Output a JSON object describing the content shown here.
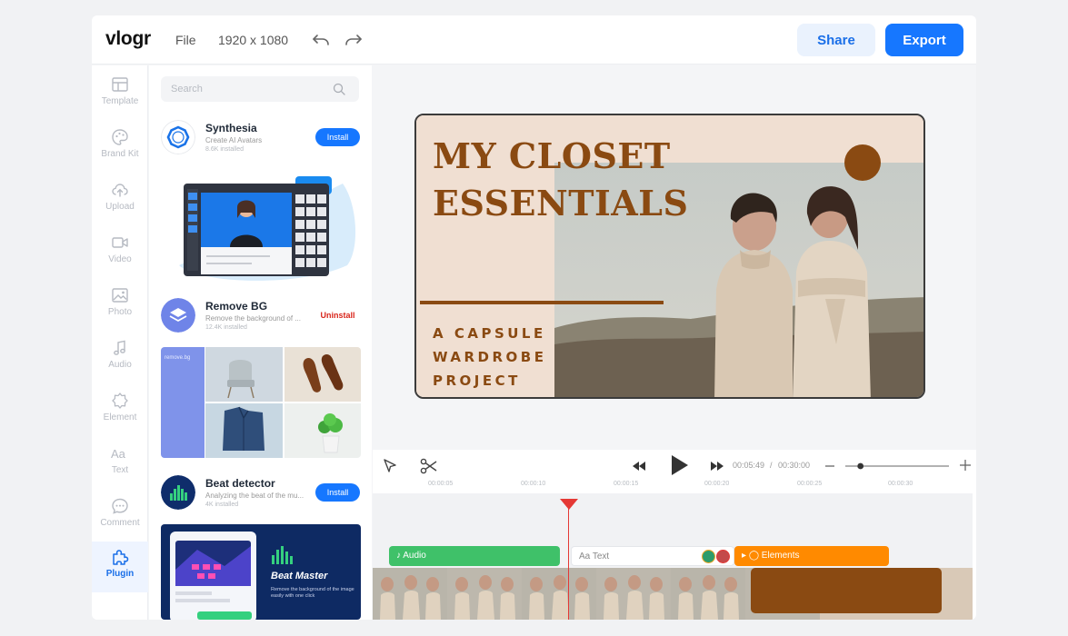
{
  "header": {
    "logo": "vlogr",
    "file_menu": "File",
    "canvas_size": "1920 x 1080",
    "share_label": "Share",
    "export_label": "Export"
  },
  "sidebar": {
    "items": [
      {
        "label": "Template",
        "icon": "template-icon"
      },
      {
        "label": "Brand Kit",
        "icon": "palette-icon"
      },
      {
        "label": "Upload",
        "icon": "cloud-upload-icon"
      },
      {
        "label": "Video",
        "icon": "video-icon"
      },
      {
        "label": "Photo",
        "icon": "photo-icon"
      },
      {
        "label": "Audio",
        "icon": "music-note-icon"
      },
      {
        "label": "Element",
        "icon": "element-icon"
      },
      {
        "label": "Text",
        "icon": "text-icon"
      },
      {
        "label": "Comment",
        "icon": "comment-icon"
      },
      {
        "label": "Plugin",
        "icon": "puzzle-icon",
        "active": true
      }
    ]
  },
  "plugin_panel": {
    "search_placeholder": "Search",
    "plugins": [
      {
        "name": "Synthesia",
        "description": "Create AI Avatars",
        "installs": "8.6K installed",
        "action": "Install"
      },
      {
        "name": "Remove BG",
        "description": "Remove the background of ...",
        "installs": "12.4K installed",
        "action": "Uninstall"
      },
      {
        "name": "Beat detector",
        "description": "Analyzing the beat of the mu...",
        "installs": "4K installed",
        "action": "Install"
      }
    ],
    "beat_master": {
      "title": "Beat Master",
      "caption": "Remove the background of the image easily with one click"
    },
    "removebg_brand": "remove.bg"
  },
  "canvas": {
    "title_line1": "MY CLOSET",
    "title_line2": "ESSENTIALS",
    "subtitle_line1": "A CAPSULE",
    "subtitle_line2": "WARDROBE",
    "subtitle_line3": "PROJECT",
    "accent_color": "#8a4a12",
    "background_color": "#f0dfd2"
  },
  "timeline": {
    "current_time": "00:05:49",
    "separator": "/",
    "total_time": "00:30:00",
    "ruler": [
      "00:00:05",
      "00:00:10",
      "00:00:15",
      "00:00:20",
      "00:00:25",
      "00:00:30"
    ],
    "zoom_level": 0.12,
    "tracks": {
      "audio_label": "Audio",
      "text_label": "Text",
      "elements_label": "Elements"
    }
  }
}
